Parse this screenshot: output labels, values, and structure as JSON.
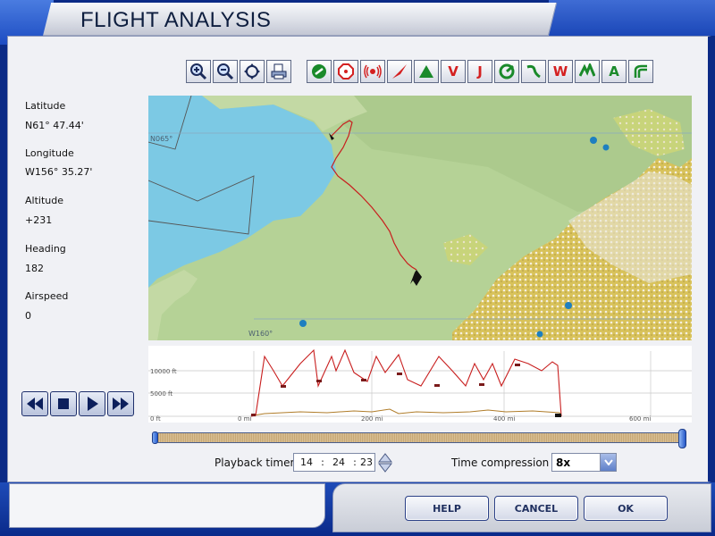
{
  "window": {
    "title": "FLIGHT ANALYSIS"
  },
  "toolbar": {
    "view_tools": [
      {
        "name": "zoom-in-icon"
      },
      {
        "name": "zoom-out-icon"
      },
      {
        "name": "center-crosshair-icon"
      },
      {
        "name": "print-icon"
      }
    ],
    "filter_tools": [
      {
        "name": "airport-icon",
        "glyph": "",
        "color": "#1a8a2a"
      },
      {
        "name": "ndb-icon",
        "glyph": "",
        "color": "#d42020"
      },
      {
        "name": "vor-icon",
        "glyph": "",
        "color": "#d42020"
      },
      {
        "name": "flight-path-icon",
        "glyph": "",
        "color": "#d42020"
      },
      {
        "name": "intersection-icon",
        "glyph": "",
        "color": "#1a8a2a"
      },
      {
        "name": "victor-airway-icon",
        "glyph": "V",
        "color": "#d42020"
      },
      {
        "name": "jet-airway-icon",
        "glyph": "J",
        "color": "#d42020"
      },
      {
        "name": "approach-icon",
        "glyph": "",
        "color": "#1a8a2a"
      },
      {
        "name": "terrain-icon",
        "glyph": "",
        "color": "#1a8a2a"
      },
      {
        "name": "weather-icon",
        "glyph": "W",
        "color": "#d42020"
      },
      {
        "name": "airspace-icon",
        "glyph": "",
        "color": "#1a8a2a"
      },
      {
        "name": "altitude-label-icon",
        "glyph": "A",
        "color": "#1a8a2a"
      },
      {
        "name": "runway-icon",
        "glyph": "",
        "color": "#1a8a2a"
      }
    ]
  },
  "info": {
    "latitude_label": "Latitude",
    "latitude": "N61° 47.44'",
    "longitude_label": "Longitude",
    "longitude": "W156° 35.27'",
    "altitude_label": "Altitude",
    "altitude": "+231",
    "heading_label": "Heading",
    "heading": "182",
    "airspeed_label": "Airspeed",
    "airspeed": "0"
  },
  "map": {
    "lat_label": "N065°",
    "lon_label": "W160°"
  },
  "profile": {
    "y_labels": [
      "10000 ft",
      "5000 ft",
      "0 ft"
    ],
    "x_labels": [
      "0 mi",
      "200 mi",
      "400 mi",
      "600 mi"
    ]
  },
  "playback": {
    "position": 1.0,
    "timer_label": "Playback timer",
    "hours": "14",
    "minutes": "24",
    "seconds": "23",
    "sep": ":",
    "compression_label": "Time compression",
    "compression_value": "8x"
  },
  "buttons": {
    "help": "HELP",
    "cancel": "CANCEL",
    "ok": "OK"
  }
}
